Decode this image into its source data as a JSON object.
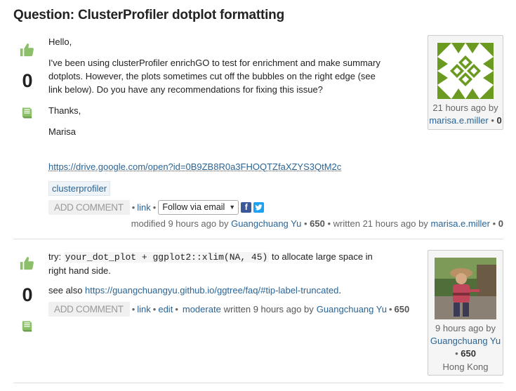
{
  "question_title": "Question: ClusterProfiler dotplot formatting",
  "question": {
    "vote_count": "0",
    "greeting": "Hello,",
    "body": "I've been using clusterProfiler enrichGO to test for enrichment and make summary dotplots. However, the plots sometimes cut off the bubbles on the right edge (see link below). Do you have any recommendations for fixing this issue?",
    "thanks": "Thanks,",
    "signature": "Marisa",
    "link_url": "https://drive.google.com/open?id=0B9ZB8R0a3FHOQTZfaXZYS3QtM2c",
    "tag": "clusterprofiler",
    "add_comment": "ADD COMMENT",
    "link_label": "link",
    "follow_label": "Follow via email",
    "meta": {
      "modified_text": "modified 9 hours ago by",
      "modified_user": "Guangchuang Yu",
      "modified_rep": "650",
      "written_text": "written 21 hours ago by",
      "written_user": "marisa.e.miller",
      "written_rep": "0"
    },
    "user": {
      "time": "21 hours ago by",
      "name": "marisa.e.miller",
      "rep": "0"
    }
  },
  "answer": {
    "vote_count": "0",
    "try_label": "try:",
    "code": "your_dot_plot + ggplot2::xlim(NA, 45)",
    "body_after_code": "to allocate large space in right hand side.",
    "see_also": "see also",
    "see_also_url": "https://guangchuangyu.github.io/ggtree/faq/#tip-label-truncated",
    "see_also_end": ".",
    "add_comment": "ADD COMMENT",
    "link_label": "link",
    "edit_label": "edit",
    "moderate_label": "moderate",
    "written_text": "written 9 hours ago by",
    "written_user": "Guangchuang Yu",
    "written_rep": "650",
    "user": {
      "time": "9 hours ago by",
      "name": "Guangchuang Yu",
      "rep": "650",
      "location": "Hong Kong"
    }
  },
  "colors": {
    "link": "#2a6496",
    "vote_icon": "#8bbf6a",
    "avatar_green": "#6a9a1f",
    "facebook": "#3b5998",
    "twitter": "#1da1f2"
  },
  "icons": {
    "upvote": "thumbs-up-icon",
    "bookmark": "book-icon",
    "facebook": "facebook-icon",
    "twitter": "twitter-icon"
  }
}
